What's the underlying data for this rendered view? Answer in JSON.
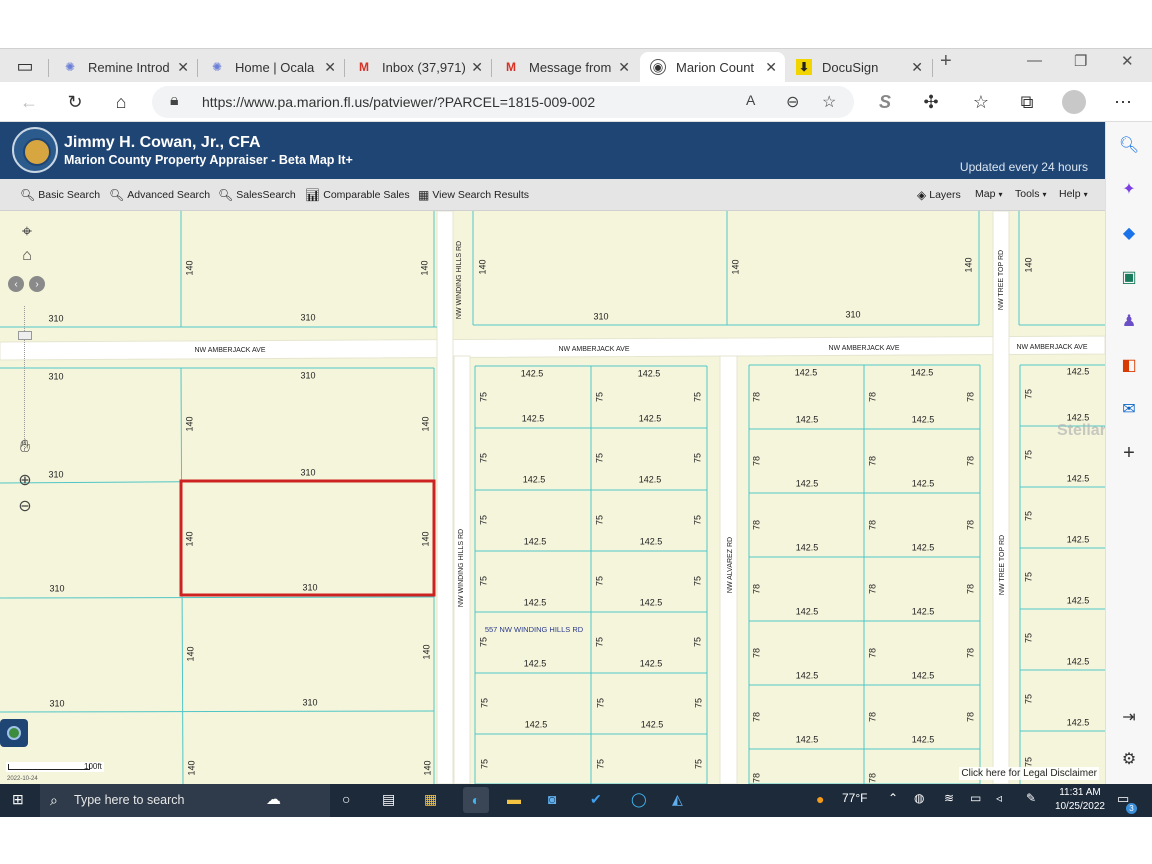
{
  "browser": {
    "tabs": [
      {
        "label": "Remine Introd",
        "icon": "gear-icon"
      },
      {
        "label": "Home | Ocala",
        "icon": "gear-icon"
      },
      {
        "label": "Inbox (37,971)",
        "icon": "gmail-icon"
      },
      {
        "label": "Message from",
        "icon": "gmail-icon"
      },
      {
        "label": "Marion Count",
        "icon": "seal-icon"
      },
      {
        "label": "DocuSign",
        "icon": "download-icon"
      }
    ],
    "url": "https://www.pa.marion.fl.us/patviewer/?PARCEL=1815-009-002"
  },
  "header": {
    "name": "Jimmy H. Cowan, Jr., CFA",
    "subtitle": "Marion County Property Appraiser - Beta Map It+",
    "updated": "Updated every 24 hours"
  },
  "toolbar": {
    "basic_search": "Basic Search",
    "advanced_search": "Advanced Search",
    "sales_search": "SalesSearch",
    "comparable_sales": "Comparable Sales",
    "view_results": "View Search Results",
    "layers": "Layers",
    "map": "Map",
    "tools": "Tools",
    "help": "Help"
  },
  "map": {
    "streets": {
      "amberjack": "NW AMBERJACK AVE",
      "winding_hills": "NW WINDING HILLS RD",
      "alvarez": "NW ALVAREZ RD",
      "tree_top": "NW TREE TOP RD"
    },
    "address_label": "557 NW WINDING HILLS RD",
    "dims": {
      "d310": "310",
      "d140": "140",
      "d1425": "142.5",
      "d75": "75",
      "d78": "78"
    },
    "scale_label": "100ft",
    "scale_date": "2022-10-24",
    "disclaimer": "Click here for Legal Disclaimer",
    "watermark": "StellarMLS",
    "colors": {
      "parcel_fill": "#f5f5dc",
      "parcel_line": "#4fc6c6",
      "selected_outline": "#cc2222",
      "street": "#ffffff"
    }
  },
  "taskbar": {
    "search_placeholder": "Type here to search",
    "weather": "77°F",
    "time": "11:31 AM",
    "date": "10/25/2022",
    "notification_count": "3"
  }
}
